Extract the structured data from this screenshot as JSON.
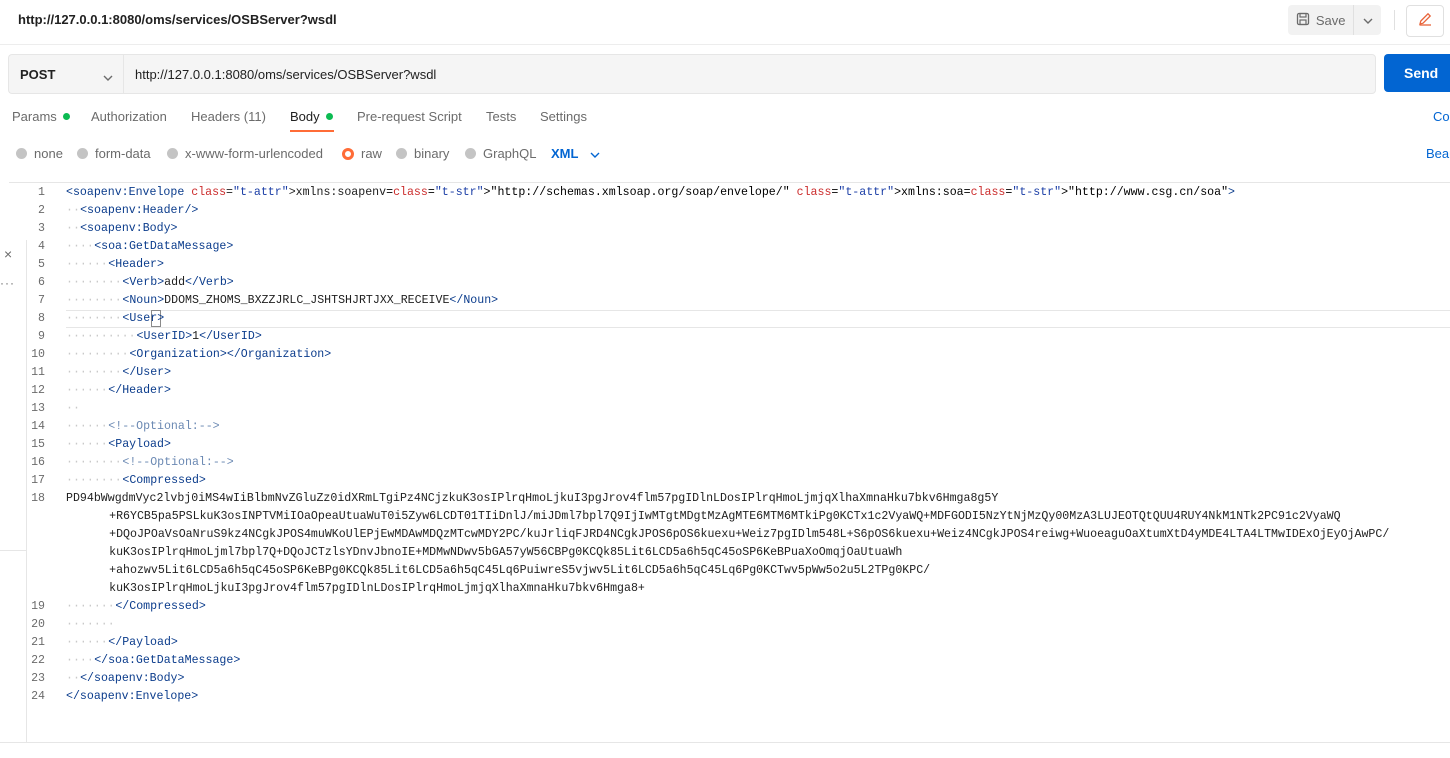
{
  "header": {
    "title": "http://127.0.0.1:8080/oms/services/OSBServer?wsdl",
    "save_label": "Save"
  },
  "request": {
    "method": "POST",
    "url": "http://127.0.0.1:8080/oms/services/OSBServer?wsdl",
    "send_label": "Send"
  },
  "tabs": [
    {
      "label": "Params",
      "dot": true
    },
    {
      "label": "Authorization"
    },
    {
      "label": "Headers (11)"
    },
    {
      "label": "Body",
      "dot": true,
      "active": true
    },
    {
      "label": "Pre-request Script"
    },
    {
      "label": "Tests"
    },
    {
      "label": "Settings"
    }
  ],
  "right_links": {
    "cookies": "Co",
    "beautify": "Beau"
  },
  "body_types": [
    {
      "label": "none"
    },
    {
      "label": "form-data"
    },
    {
      "label": "x-www-form-urlencoded"
    },
    {
      "label": "raw",
      "selected": true
    },
    {
      "label": "binary"
    },
    {
      "label": "GraphQL"
    }
  ],
  "language": "XML",
  "colors": {
    "accent": "#ff6c37",
    "primary": "#0265d2",
    "success": "#0cbb52"
  },
  "code": {
    "line_numbers": [
      "1",
      "2",
      "3",
      "4",
      "5",
      "6",
      "7",
      "8",
      "9",
      "10",
      "11",
      "12",
      "13",
      "14",
      "15",
      "16",
      "17",
      "18",
      "",
      "",
      "",
      "",
      "",
      "19",
      "20",
      "21",
      "22",
      "23",
      "24"
    ],
    "lines": [
      "<soapenv:Envelope xmlns:soapenv=\"http://schemas.xmlsoap.org/soap/envelope/\" xmlns:soa=\"http://www.csg.cn/soa\">",
      "<soapenv:Header/>",
      "<soapenv:Body>",
      "<soa:GetDataMessage>",
      "<Header>",
      "<Verb>add</Verb>",
      "<Noun>DDOMS_ZHOMS_BXZZJRLC_JSHTSHJRTJXX_RECEIVE</Noun>",
      "<User>",
      "<UserID>1</UserID>",
      "<Organization></Organization>",
      "</User>",
      "</Header>",
      "",
      "<!--Optional:-->",
      "<Payload>",
      "<!--Optional:-->",
      "<Compressed>",
      "PD94bWwgdmVyc2lvbj0iMS4wIiBlbmNvZGluZz0idXRmLTgiPz4NCjzkuK3osIPlrqHmoLjkuI3pgJrov4flm57pgIDlnLDosIPlrqHmoLjmjqXlhaXmnaHku7bkv6Hmga8g5Y",
      "+R6YCB5pa5PSLkuK3osINPTVMiIOaOpeaUtuaWuT0i5Zyw6LCDT01TIiDnlJ/miJDml7bpl7Q9IjIwMTgtMDgtMzAgMTE6MTM6MTkiPg0KCTx1c2VyaWQ+MDFGODI5NzYtNjMzQy00MzA3LUJEOTQtQUU4RUY4NkM1NTk2PC91c2VyaWQ",
      "+DQoJPOaVsOaNruS9kz4NCgkJPOS4muWKoUlEPjEwMDAwMDQzMTcwMDY2PC/kuJrliqFJRD4NCgkJPOS6pOS6kuexu+Weiz7pgIDlm548L+S6pOS6kuexu+Weiz4NCgkJPOS4reiwg+WuoeaguOaXtumXtD4yMDE4LTA4LTMwIDExOjEyOjAwPC/",
      "kuK3osIPlrqHmoLjml7bpl7Q+DQoJCTzlsYDnvJbnoIE+MDMwNDwv5bGA57yW56CBPg0KCQk85Lit6LCD5a6h5qC45oSP6KeBPuaXoOmqjOaUtuaWh",
      "+ahozwv5Lit6LCD5a6h5qC45oSP6KeBPg0KCQk85Lit6LCD5a6h5qC45Lq6PuiwreS5vjwv5Lit6LCD5a6h5qC45Lq6Pg0KCTwv5pWw5o2u5L2TPg0KPC/",
      "kuK3osIPlrqHmoLjkuI3pgJrov4flm57pgIDlnLDosIPlrqHmoLjmjqXlhaXmnaHku7bkv6Hmga8+",
      "</Compressed>",
      "",
      "</Payload>",
      "</soa:GetDataMessage>",
      "</soapenv:Body>",
      "</soapenv:Envelope>"
    ]
  }
}
